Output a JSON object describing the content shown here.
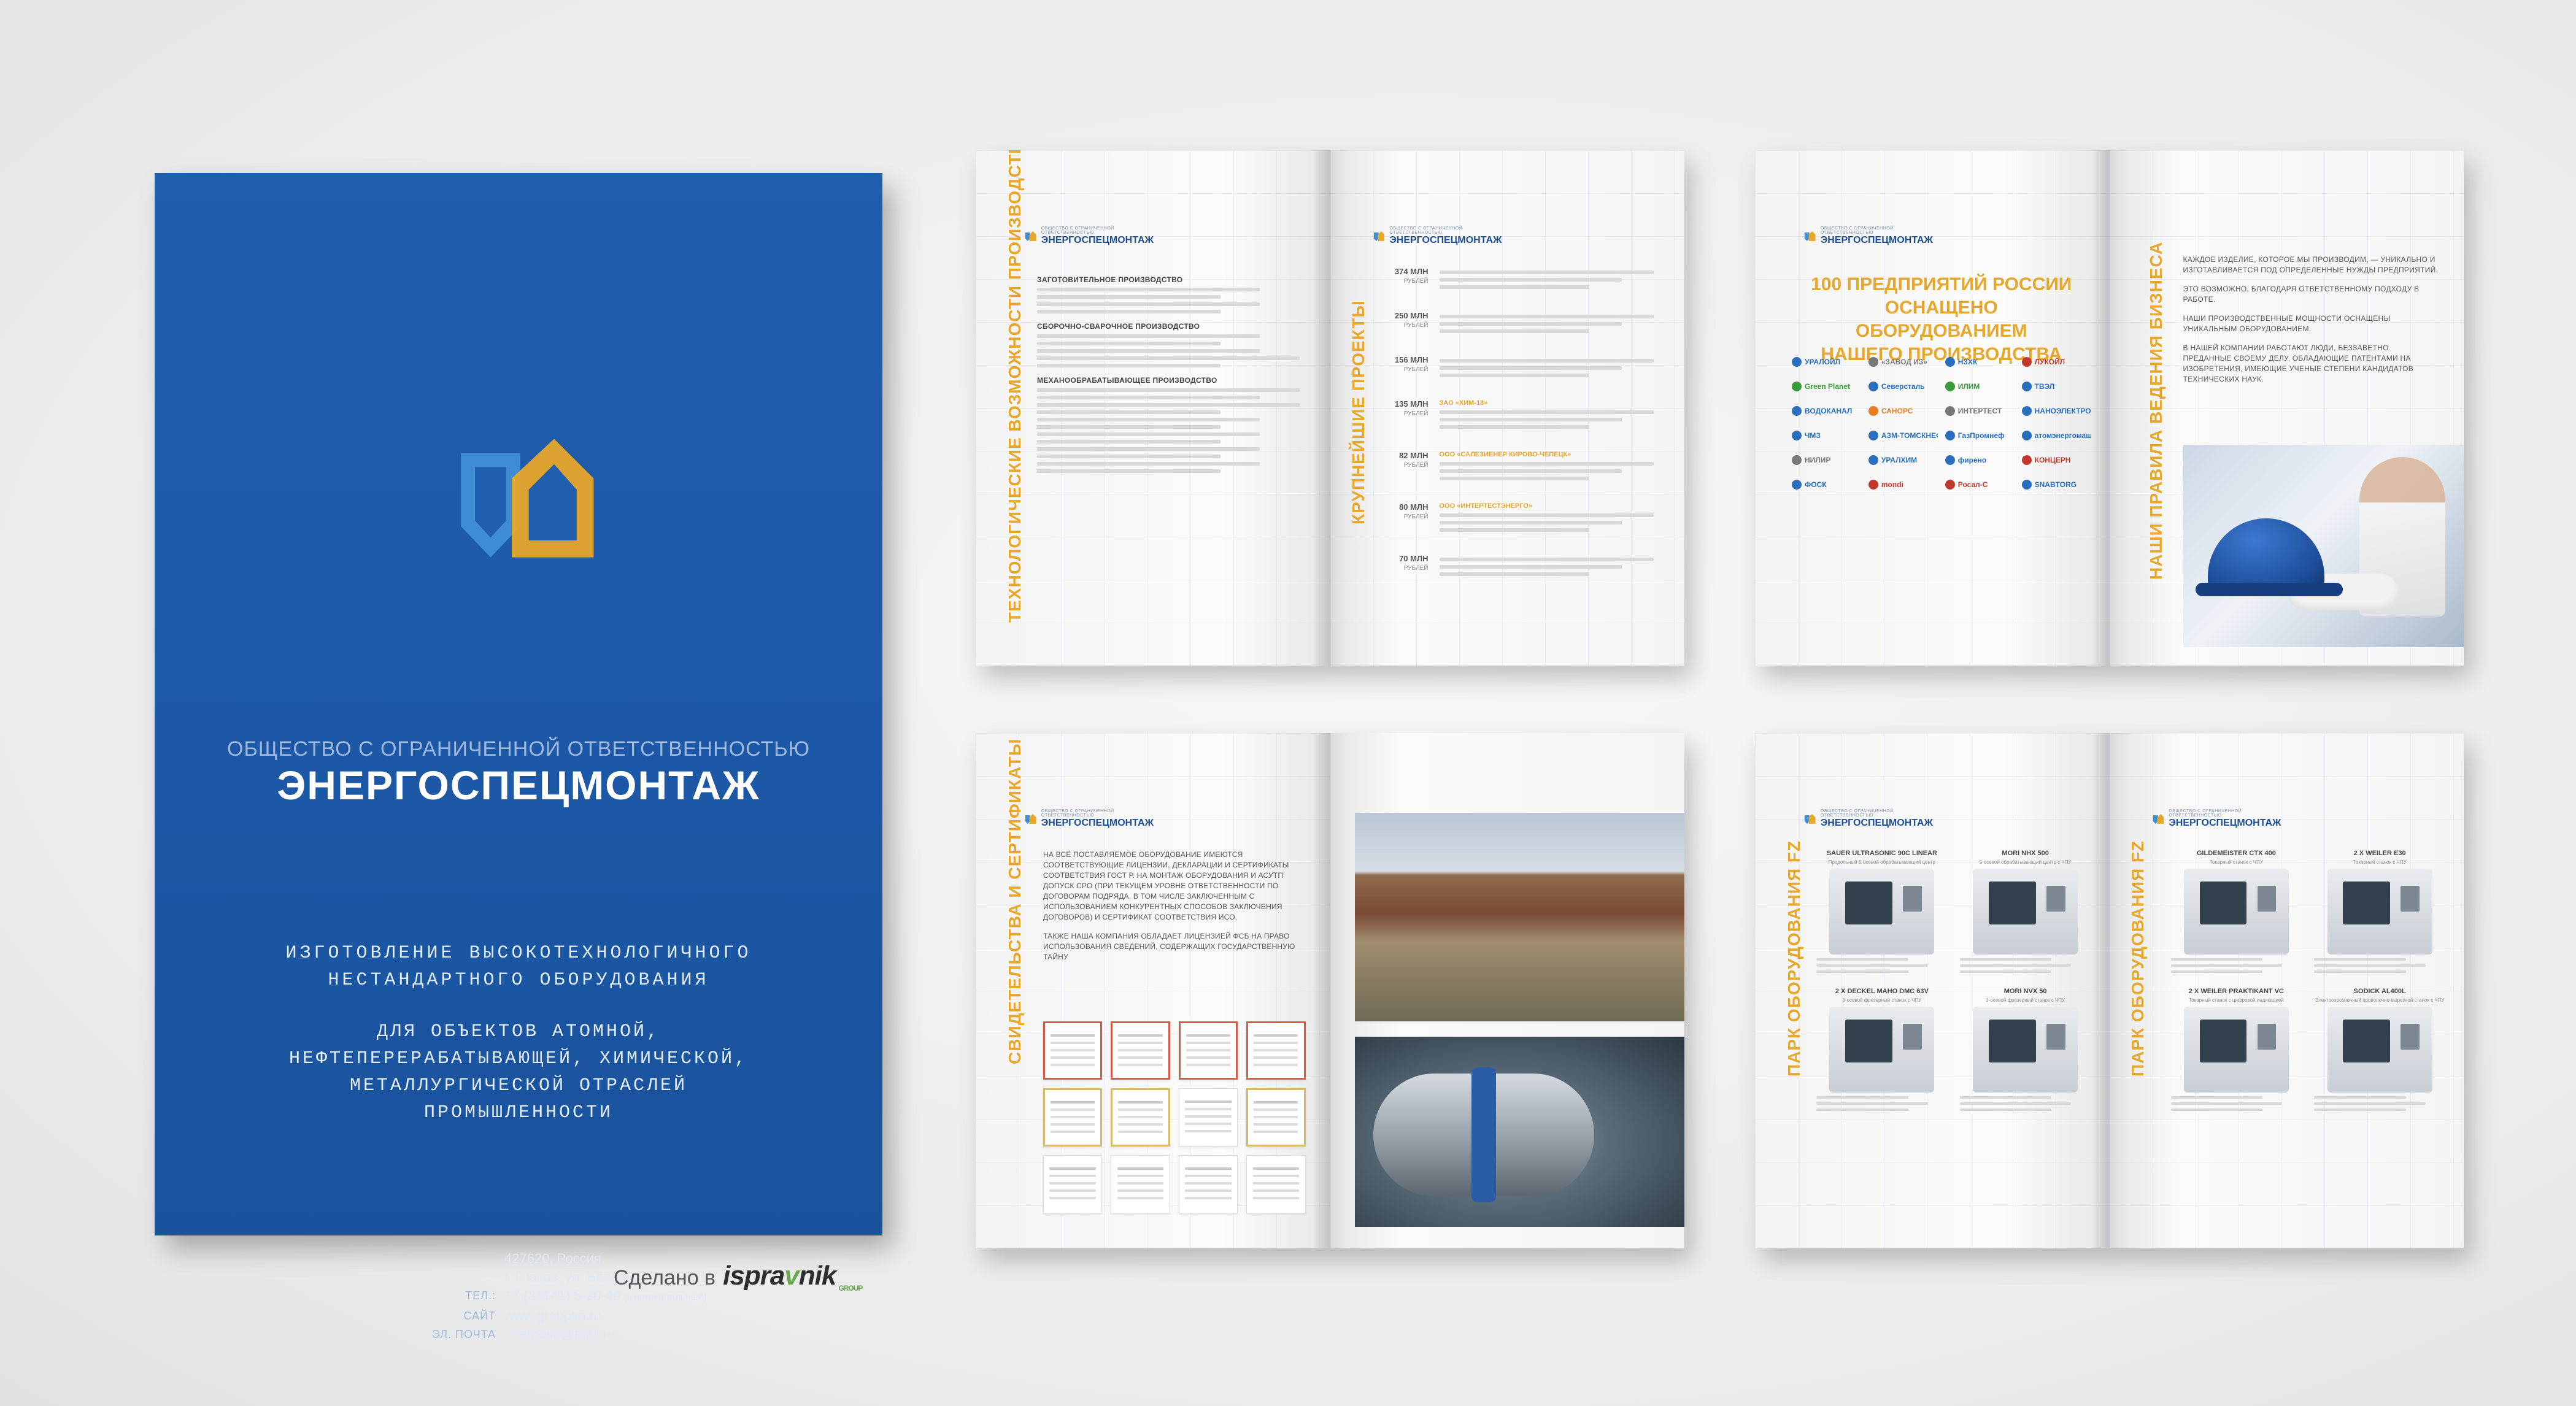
{
  "cover": {
    "company_sub": "ОБЩЕСТВО С ОГРАНИЧЕННОЙ ОТВЕТСТВЕННОСТЬЮ",
    "company_name": "ЭНЕРГОСПЕЦМОНТАЖ",
    "headline_1": "ИЗГОТОВЛЕНИЕ ВЫСОКОТЕХНОЛОГИЧНОГО",
    "headline_2": "НЕСТАНДАРТНОГО ОБОРУДОВАНИЯ",
    "sub_1": "ДЛЯ ОБЪЕКТОВ АТОМНОЙ,",
    "sub_2": "НЕФТЕПЕРЕРАБАТЫВАЮЩЕЙ, ХИМИЧЕСКОЙ,",
    "sub_3": "МЕТАЛЛУРГИЧЕСКОЙ ОТРАСЛЕЙ",
    "sub_4": "ПРОМЫШЛЕННОСТИ",
    "address_1": "427620, Россия,",
    "address_2": "г. Глазов, ул. Белова, 5",
    "phone_label": "ТЕЛ.:",
    "phone": "+7 (34141) 5-26-46",
    "phone_note": "(многоканальный)",
    "site_label": "САЙТ",
    "site": "www.groupso.ru",
    "email_label": "ЭЛ. ПОЧТА",
    "email": "energoso@mail.ru",
    "colors": {
      "blue": "#1f5fae",
      "orange": "#e6a72b"
    }
  },
  "made_by": {
    "prefix": "Сделано в",
    "brand_a": "ispra",
    "brand_v": "v",
    "brand_b": "nik",
    "brand_sub": "GROUP"
  },
  "spreads": {
    "tech": {
      "logo_name": "ЭНЕРГОСПЕЦМОНТАЖ",
      "logo_sub": "ОБЩЕСТВО С ОГРАНИЧЕННОЙ ОТВЕТСТВЕННОСТЬЮ",
      "title": "ТЕХНОЛОГИЧЕСКИЕ ВОЗМОЖНОСТИ ПРОИЗВОДСТВА",
      "block_1": "ЗАГОТОВИТЕЛЬНОЕ ПРОИЗВОДСТВО",
      "block_2": "СБОРОЧНО-СВАРОЧНОЕ ПРОИЗВОДСТВО",
      "block_3": "МЕХАНООБРАБАТЫВАЮЩЕЕ ПРОИЗВОДСТВО"
    },
    "projects": {
      "title": "КРУПНЕЙШИЕ ПРОЕКТЫ",
      "items": [
        {
          "sum": "374 МЛН",
          "cur": "РУБЛЕЙ",
          "name": ""
        },
        {
          "sum": "250 МЛН",
          "cur": "РУБЛЕЙ",
          "name": ""
        },
        {
          "sum": "156 МЛН",
          "cur": "РУБЛЕЙ",
          "name": ""
        },
        {
          "sum": "135 МЛН",
          "cur": "РУБЛЕЙ",
          "name": "ЗАО «ХИМ-18»"
        },
        {
          "sum": "82 МЛН",
          "cur": "РУБЛЕЙ",
          "name": "ООО «САЛЕЗИЕНЕР КИРОВО-ЧЕПЕЦК»"
        },
        {
          "sum": "80 МЛН",
          "cur": "РУБЛЕЙ",
          "name": "ООО «ИНТЕРТЕСТЭНЕРГО»"
        },
        {
          "sum": "70 МЛН",
          "cur": "РУБЛЕЙ",
          "name": ""
        }
      ]
    },
    "partners": {
      "title_1": "100 ПРЕДПРИЯТИЙ РОССИИ",
      "title_2": "ОСНАЩЕНО ОБОРУДОВАНИЕМ",
      "title_3": "НАШЕГО ПРОИЗВОДСТВА",
      "logos": [
        {
          "name": "УРАЛОЙЛ",
          "color": "#2a6fbe"
        },
        {
          "name": "«ЗАВОД ИЗ»",
          "color": "#777777"
        },
        {
          "name": "НЗХК",
          "color": "#2a6fbe"
        },
        {
          "name": "ЛУКОЙЛ",
          "color": "#c0392b"
        },
        {
          "name": "Green Planet",
          "color": "#3a9b3a"
        },
        {
          "name": "Северсталь",
          "color": "#2a6fbe"
        },
        {
          "name": "ИЛИМ",
          "color": "#3a9b3a"
        },
        {
          "name": "ТВЭЛ",
          "color": "#2a6fbe"
        },
        {
          "name": "ВОДОКАНАЛ",
          "color": "#2a6fbe"
        },
        {
          "name": "САНОРС",
          "color": "#e67e22"
        },
        {
          "name": "ИНТЕРТЕСТ",
          "color": "#777777"
        },
        {
          "name": "НАНОЭЛЕКТРО",
          "color": "#2a6fbe"
        },
        {
          "name": "ЧМЗ",
          "color": "#2a6fbe"
        },
        {
          "name": "АЗМ-ТОМСКНЕФТЬ",
          "color": "#2a6fbe"
        },
        {
          "name": "ГазПромнеф",
          "color": "#2a6fbe"
        },
        {
          "name": "атомэнергомаш",
          "color": "#2a6fbe"
        },
        {
          "name": "НИЛИР",
          "color": "#777777"
        },
        {
          "name": "УРАЛХИМ",
          "color": "#2a6fbe"
        },
        {
          "name": "фирено",
          "color": "#2a6fbe"
        },
        {
          "name": "КОНЦЕРН",
          "color": "#c0392b"
        },
        {
          "name": "ФОСК",
          "color": "#2a6fbe"
        },
        {
          "name": "mondi",
          "color": "#c0392b"
        },
        {
          "name": "Росал-С",
          "color": "#c0392b"
        },
        {
          "name": "SNABTORG",
          "color": "#2a6fbe"
        }
      ]
    },
    "rules": {
      "title": "НАШИ ПРАВИЛА ВЕДЕНИЯ БИЗНЕСА",
      "p1": "КАЖДОЕ ИЗДЕЛИЕ, КОТОРОЕ МЫ ПРОИЗВОДИМ, — УНИКАЛЬНО И ИЗГОТАВЛИВАЕТСЯ ПОД ОПРЕДЕЛЕННЫЕ НУЖДЫ ПРЕДПРИЯТИЙ.",
      "p2": "ЭТО ВОЗМОЖНО, БЛАГОДАРЯ ОТВЕТСТВЕННОМУ ПОДХОДУ В РАБОТЕ.",
      "p3": "НАШИ ПРОИЗВОДСТВЕННЫЕ МОЩНОСТИ ОСНАЩЕНЫ УНИКАЛЬНЫМ ОБОРУДОВАНИЕМ.",
      "p4": "В НАШЕЙ КОМПАНИИ РАБОТАЮТ ЛЮДИ, БЕЗЗАВЕТНО ПРЕДАННЫЕ СВОЕМУ ДЕЛУ, ОБЛАДАЮЩИЕ ПАТЕНТАМИ НА ИЗОБРЕТЕНИЯ, ИМЕЮЩИЕ УЧЕНЫЕ СТЕПЕНИ КАНДИДАТОВ ТЕХНИЧЕСКИХ НАУК."
    },
    "certs": {
      "title": "СВИДЕТЕЛЬСТВА И СЕРТИФИКАТЫ",
      "p1": "НА ВСЁ ПОСТАВЛЯЕМОЕ ОБОРУДОВАНИЕ ИМЕЮТСЯ СООТВЕТСТВУЮЩИЕ ЛИЦЕНЗИИ, ДЕКЛАРАЦИИ И СЕРТИФИКАТЫ СООТВЕТСТВИЯ ГОСТ Р. НА МОНТАЖ ОБОРУДОВАНИЯ И АСУТП ДОПУСК СРО (ПРИ ТЕКУЩЕМ УРОВНЕ ОТВЕТСТВЕННОСТИ ПО ДОГОВОРАМ ПОДРЯДА, В ТОМ ЧИСЛЕ ЗАКЛЮЧЕННЫМ С ИСПОЛЬЗОВАНИЕМ КОНКУРЕНТНЫХ СПОСОБОВ ЗАКЛЮЧЕНИЯ ДОГОВОРОВ) И СЕРТИФИКАТ СООТВЕТСТВИЯ ИСО.",
      "p2": "ТАКЖЕ НАША КОМПАНИЯ ОБЛАДАЕТ ЛИЦЕНЗИЕЙ ФСБ НА ПРАВО ИСПОЛЬЗОВАНИЯ СВЕДЕНИЙ, СОДЕРЖАЩИХ ГОСУДАРСТВЕННУЮ ТАЙНУ"
    },
    "machines_left": {
      "title": "ПАРК ОБОРУДОВАНИЯ FZ",
      "items": [
        {
          "name": "SAUER ULTRASONIC 90C LINEAR",
          "sub": "Продольный 5-осевой обрабатывающий центр"
        },
        {
          "name": "MORI NHX 500",
          "sub": "5-осевой обрабатывающий центр с ЧПУ"
        },
        {
          "name": "2 X DECKEL MAHO DMC 63V",
          "sub": "3-осевой фрезерный станок с ЧПУ"
        },
        {
          "name": "MORI NVX 50",
          "sub": "3-осевой фрезерный станок с ЧПУ"
        }
      ]
    },
    "machines_right": {
      "title": "ПАРК ОБОРУДОВАНИЯ FZ",
      "items": [
        {
          "name": "GILDEMEISTER CTX 400",
          "sub": "Токарный станок с ЧПУ"
        },
        {
          "name": "2 X WEILER E30",
          "sub": "Токарный станок с ЧПУ"
        },
        {
          "name": "2 X WEILER PRAKTIKANT VC",
          "sub": "Токарный станок с цифровой индикацией"
        },
        {
          "name": "SODICK AL400L",
          "sub": "Электроэрозионный проволочно-вырезной станок с ЧПУ"
        }
      ]
    }
  }
}
